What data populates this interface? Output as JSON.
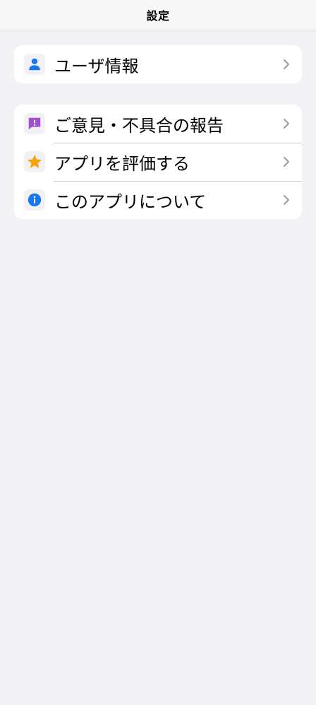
{
  "header": {
    "title": "設定"
  },
  "groups": [
    {
      "items": [
        {
          "label": "ユーザ情報",
          "icon": "person-icon",
          "icon_color": "#1677f0"
        }
      ]
    },
    {
      "items": [
        {
          "label": "ご意見・不具合の報告",
          "icon": "feedback-bubble-icon",
          "icon_color": "#a34fd1"
        },
        {
          "label": "アプリを評価する",
          "icon": "star-icon",
          "icon_color": "#f7a20d"
        },
        {
          "label": "このアプリについて",
          "icon": "info-icon",
          "icon_color": "#1677f0"
        }
      ]
    }
  ],
  "colors": {
    "background": "#f2f1f6",
    "card": "#ffffff",
    "chevron": "#9a9aa0",
    "separator": "#c6c6c8"
  }
}
